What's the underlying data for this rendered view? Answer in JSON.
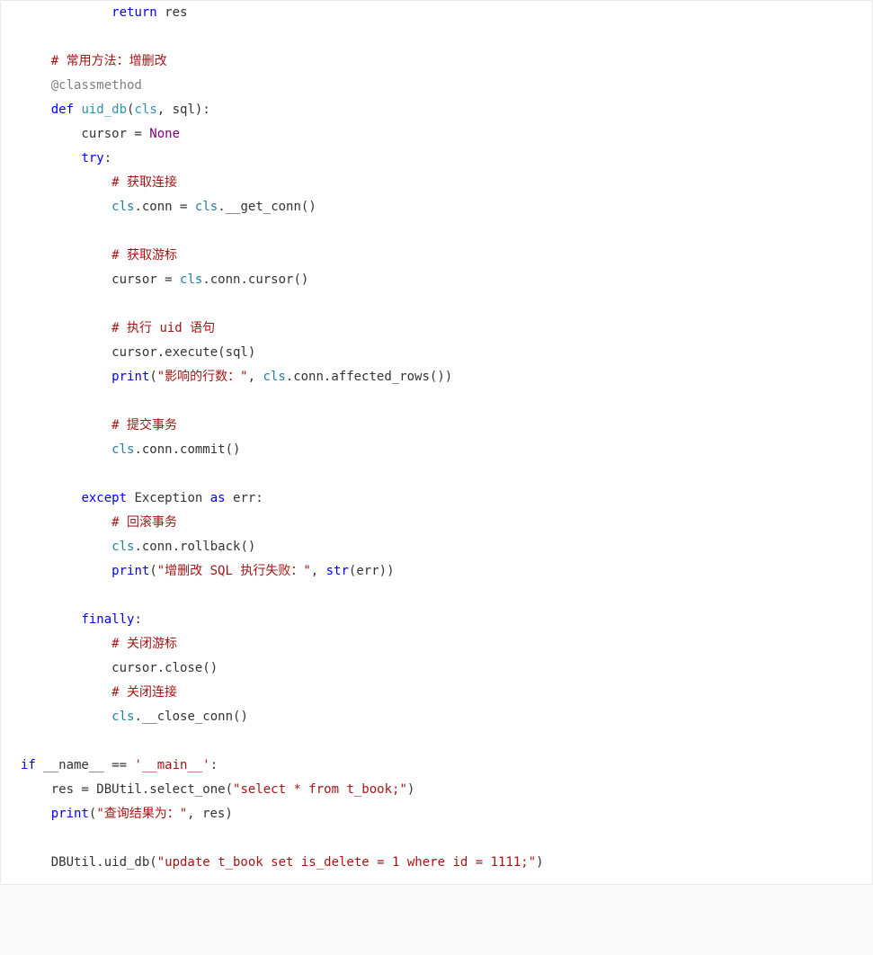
{
  "code": {
    "l01a": "            ",
    "l01_kw": "return",
    "l01b": " res",
    "l02": "",
    "l03a": "    ",
    "l03_c": "# 常用方法：增删改",
    "l04a": "    ",
    "l04_dec": "@classmethod",
    "l05a": "    ",
    "l05_def": "def",
    "l05b": " ",
    "l05_fn": "uid_db",
    "l05c": "(",
    "l05_cls": "cls",
    "l05d": ", sql):",
    "l06a": "        cursor = ",
    "l06_none": "None",
    "l07a": "        ",
    "l07_try": "try",
    "l07b": ":",
    "l08a": "            ",
    "l08_c": "# 获取连接",
    "l09a": "            ",
    "l09_cls": "cls",
    "l09b": ".conn = ",
    "l09_cls2": "cls",
    "l09c": ".__get_conn()",
    "l10": "",
    "l11a": "            ",
    "l11_c": "# 获取游标",
    "l12a": "            cursor = ",
    "l12_cls": "cls",
    "l12b": ".conn.cursor()",
    "l13": "",
    "l14a": "            ",
    "l14_c": "# 执行 uid 语句",
    "l15a": "            cursor.execute(sql)",
    "l16a": "            ",
    "l16_pr": "print",
    "l16b": "(",
    "l16_s": "\"影响的行数：\"",
    "l16c": ", ",
    "l16_cls": "cls",
    "l16d": ".conn.affected_rows())",
    "l17": "",
    "l18a": "            ",
    "l18_c": "# 提交事务",
    "l19a": "            ",
    "l19_cls": "cls",
    "l19b": ".conn.commit()",
    "l20": "",
    "l21a": "        ",
    "l21_ex": "except",
    "l21b": " Exception ",
    "l21_as": "as",
    "l21c": " err:",
    "l22a": "            ",
    "l22_c": "# 回滚事务",
    "l23a": "            ",
    "l23_cls": "cls",
    "l23b": ".conn.rollback()",
    "l24a": "            ",
    "l24_pr": "print",
    "l24b": "(",
    "l24_s": "\"增删改 SQL 执行失败：\"",
    "l24c": ", ",
    "l24_str": "str",
    "l24d": "(err))",
    "l25": "",
    "l26a": "        ",
    "l26_fin": "finally",
    "l26b": ":",
    "l27a": "            ",
    "l27_c": "# 关闭游标",
    "l28a": "            cursor.close()",
    "l29a": "            ",
    "l29_c": "# 关闭连接",
    "l30a": "            ",
    "l30_cls": "cls",
    "l30b": ".__close_conn()",
    "l31": "",
    "l32_if": "if",
    "l32a": " __name__ == ",
    "l32_s": "'__main__'",
    "l32b": ":",
    "l33a": "    res = DBUtil.select_one(",
    "l33_s": "\"select * from t_book;\"",
    "l33b": ")",
    "l34a": "    ",
    "l34_pr": "print",
    "l34b": "(",
    "l34_s": "\"查询结果为：\"",
    "l34c": ", res)",
    "l35": "",
    "l36a": "    DBUtil.uid_db(",
    "l36_s": "\"update t_book set is_delete = 1 where id = 1111;\"",
    "l36b": ")"
  }
}
